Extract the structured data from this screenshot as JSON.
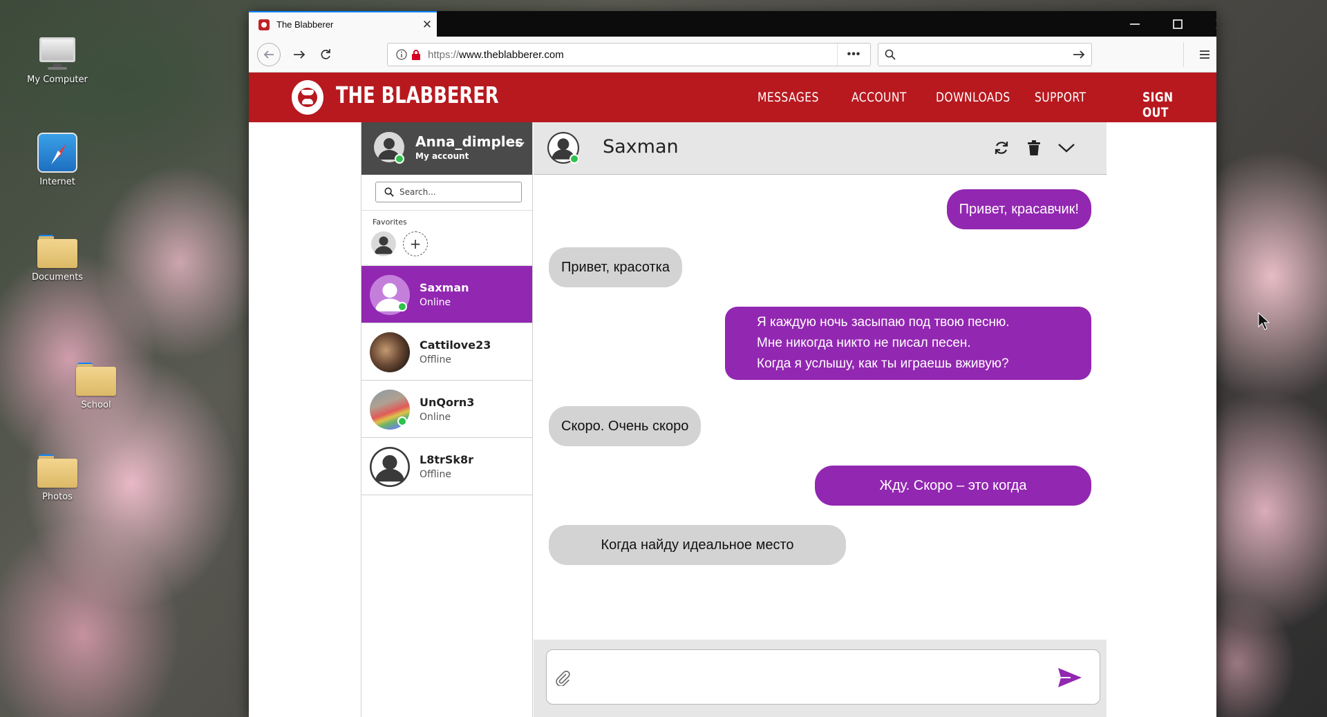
{
  "desktop": {
    "icons": [
      {
        "label": "My Computer",
        "icon": "computer-icon"
      },
      {
        "label": "Internet",
        "icon": "compass-icon"
      },
      {
        "label": "Documents",
        "icon": "folder-icon"
      },
      {
        "label": "School",
        "icon": "folder-icon"
      },
      {
        "label": "Photos",
        "icon": "folder-icon"
      }
    ]
  },
  "browser": {
    "tab_title": "The Blabberer",
    "url_protocol": "https://",
    "url_host": "www.theblabberer.com",
    "url_dots": "•••",
    "search_value": ""
  },
  "site": {
    "name": "THE BLABBERER",
    "nav": [
      "MESSAGES",
      "ACCOUNT",
      "DOWNLOADS",
      "SUPPORT"
    ],
    "signout": "SIGN OUT",
    "colors": {
      "brand_red": "#b7191f",
      "accent_purple": "#9227b1",
      "online_green": "#2ec24d"
    }
  },
  "account": {
    "username": "Anna_dimples",
    "subtitle": "My account"
  },
  "sidebar": {
    "search_placeholder": "Search...",
    "favorites_label": "Favorites",
    "fav_add": "+",
    "contacts": [
      {
        "name": "Saxman",
        "status": "Online",
        "active": true
      },
      {
        "name": "Cattilove23",
        "status": "Offline",
        "active": false
      },
      {
        "name": "UnQorn3",
        "status": "Online",
        "active": false
      },
      {
        "name": "L8trSk8r",
        "status": "Offline",
        "active": false
      }
    ]
  },
  "chat": {
    "contact_name": "Saxman",
    "messages": [
      {
        "dir": "out",
        "text": "Привет, красавчик!"
      },
      {
        "dir": "in",
        "text": "Привет, красотка"
      },
      {
        "dir": "out",
        "text": "Я каждую ночь засыпаю под твою песню.\nМне никогда никто не писал песен.\nКогда я услышу, как ты играешь вживую?"
      },
      {
        "dir": "in",
        "text": "Скоро. Очень скоро"
      },
      {
        "dir": "out",
        "text": "Жду. Скоро – это когда"
      },
      {
        "dir": "in",
        "text": "Когда найду идеальное место"
      }
    ],
    "composer_value": ""
  }
}
